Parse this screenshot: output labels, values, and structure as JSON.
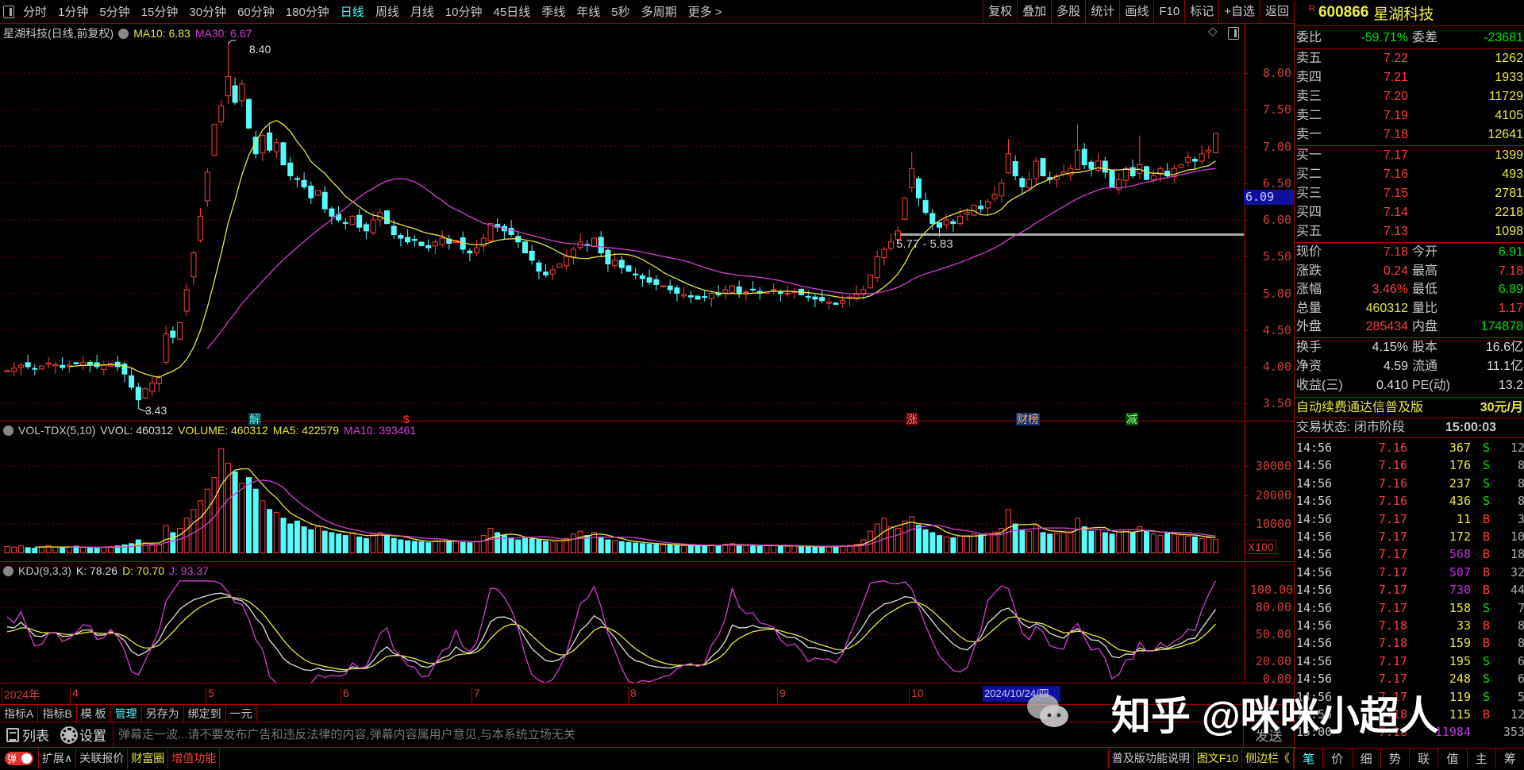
{
  "toolbar": {
    "periods": [
      "分时",
      "1分钟",
      "5分钟",
      "15分钟",
      "30分钟",
      "60分钟",
      "180分钟",
      "日线",
      "周线",
      "月线",
      "10分钟",
      "45日线",
      "季线",
      "年线",
      "5秒",
      "多周期",
      "更多 >"
    ],
    "active_period": "日线",
    "actions": [
      "复权",
      "叠加",
      "多股",
      "统计",
      "画线",
      "F10",
      "标记",
      "+自选",
      "返回"
    ]
  },
  "price_pane": {
    "title": "星湖科技(日线,前复权)",
    "ma10": "MA10: 6.83",
    "ma30": "MA30: 6.67",
    "high_label": "8.40",
    "low_label": "3.43",
    "range_label": "5.77 - 5.83",
    "current_price_tag": "6.09",
    "y_ticks": [
      "8.00",
      "7.50",
      "7.00",
      "6.50",
      "6.00",
      "5.50",
      "5.00",
      "4.50",
      "4.00",
      "3.50"
    ],
    "markers": [
      {
        "text": "解",
        "color": "#54fcfc",
        "bg": "#104040"
      },
      {
        "text": "$",
        "color": "#ff3030",
        "bg": "transparent"
      },
      {
        "text": "涨",
        "color": "#ff8080",
        "bg": "#600000"
      },
      {
        "text": "财榜",
        "color": "#ffb060",
        "bg": "#103070"
      },
      {
        "text": "减",
        "color": "#80ff80",
        "bg": "#0a500a"
      }
    ]
  },
  "volume_pane": {
    "name": "VOL-TDX(5,10)",
    "vvol": "VVOL: 460312",
    "volume": "VOLUME: 460312",
    "ma5": "MA5: 422579",
    "ma10": "MA10: 393461",
    "y_ticks": [
      "30000",
      "20000",
      "10000"
    ],
    "unit": "X100"
  },
  "kdj_pane": {
    "name": "KDJ(9,3,3)",
    "k": "K: 78.26",
    "d": "D: 70.70",
    "j": "J: 93.37",
    "y_ticks": [
      "100.00",
      "80.00",
      "50.00",
      "20.00",
      "0.00"
    ]
  },
  "date_axis": {
    "labels": [
      "2024年",
      "4",
      "5",
      "6",
      "7",
      "8",
      "9",
      "10"
    ],
    "cursor_date": "2024/10/24/四"
  },
  "indicator_tabs": [
    "指标A",
    "指标B",
    "模 板",
    "管理",
    "另存为",
    "绑定到",
    "一元"
  ],
  "list_bar": {
    "list_label": "列表",
    "settings_label": "设置",
    "danmaku_placeholder": "弹幕走一波...请不要发布广告和违反法律的内容,弹幕内容属用户意见,与本系统立场无关",
    "send_label": "发送"
  },
  "bottom_bar": {
    "toggle_label": "弹",
    "items": [
      "扩展∧",
      "关联报价",
      "财富圈",
      "增值功能"
    ],
    "right_items": [
      "普及版功能说明",
      "图文F10",
      "侧边栏《"
    ]
  },
  "quote": {
    "code": "600866",
    "name": "星湖科技",
    "badge": "R",
    "weibi": {
      "label": "委比",
      "value": "-59.71%",
      "label2": "委差",
      "value2": "-23681"
    },
    "sell": [
      {
        "label": "卖五",
        "price": "7.22",
        "vol": "1262"
      },
      {
        "label": "卖四",
        "price": "7.21",
        "vol": "1933"
      },
      {
        "label": "卖三",
        "price": "7.20",
        "vol": "11729"
      },
      {
        "label": "卖二",
        "price": "7.19",
        "vol": "4105"
      },
      {
        "label": "卖一",
        "price": "7.18",
        "vol": "12641"
      }
    ],
    "buy": [
      {
        "label": "买一",
        "price": "7.17",
        "vol": "1399"
      },
      {
        "label": "买二",
        "price": "7.16",
        "vol": "493"
      },
      {
        "label": "买三",
        "price": "7.15",
        "vol": "2781"
      },
      {
        "label": "买四",
        "price": "7.14",
        "vol": "2218"
      },
      {
        "label": "买五",
        "price": "7.13",
        "vol": "1098"
      }
    ],
    "stats": [
      {
        "l1": "现价",
        "v1": "7.18",
        "c1": "red",
        "l2": "今开",
        "v2": "6.91",
        "c2": "green"
      },
      {
        "l1": "涨跌",
        "v1": "0.24",
        "c1": "red",
        "l2": "最高",
        "v2": "7.18",
        "c2": "red"
      },
      {
        "l1": "涨幅",
        "v1": "3.46%",
        "c1": "red",
        "l2": "最低",
        "v2": "6.89",
        "c2": "green"
      },
      {
        "l1": "总量",
        "v1": "460312",
        "c1": "yellow",
        "l2": "量比",
        "v2": "1.17",
        "c2": "red"
      },
      {
        "l1": "外盘",
        "v1": "285434",
        "c1": "red",
        "l2": "内盘",
        "v2": "174878",
        "c2": "green"
      }
    ],
    "fundamentals": [
      {
        "l1": "换手",
        "v1": "4.15%",
        "l2": "股本",
        "v2": "16.6亿"
      },
      {
        "l1": "净资",
        "v1": "4.59",
        "l2": "流通",
        "v2": "11.1亿"
      },
      {
        "l1": "收益(三)",
        "v1": "0.410",
        "l2": "PE(动)",
        "v2": "13.2"
      }
    ],
    "promo": "自动续费通达信普及版",
    "promo_price": "30元/月",
    "status": "交易状态: 闭市阶段",
    "status_time": "15:00:03"
  },
  "trades": [
    {
      "t": "14:56",
      "p": "7.16",
      "v": "367",
      "bs": "S",
      "n": "12",
      "big": false
    },
    {
      "t": "14:56",
      "p": "7.16",
      "v": "176",
      "bs": "S",
      "n": "8",
      "big": false
    },
    {
      "t": "14:56",
      "p": "7.16",
      "v": "237",
      "bs": "S",
      "n": "8",
      "big": false
    },
    {
      "t": "14:56",
      "p": "7.16",
      "v": "436",
      "bs": "S",
      "n": "8",
      "big": false
    },
    {
      "t": "14:56",
      "p": "7.17",
      "v": "11",
      "bs": "B",
      "n": "3",
      "big": false
    },
    {
      "t": "14:56",
      "p": "7.17",
      "v": "172",
      "bs": "B",
      "n": "10",
      "big": false
    },
    {
      "t": "14:56",
      "p": "7.17",
      "v": "568",
      "bs": "B",
      "n": "18",
      "big": true
    },
    {
      "t": "14:56",
      "p": "7.17",
      "v": "507",
      "bs": "B",
      "n": "32",
      "big": true
    },
    {
      "t": "14:56",
      "p": "7.17",
      "v": "730",
      "bs": "B",
      "n": "44",
      "big": true
    },
    {
      "t": "14:56",
      "p": "7.17",
      "v": "158",
      "bs": "S",
      "n": "7",
      "big": false
    },
    {
      "t": "14:56",
      "p": "7.18",
      "v": "33",
      "bs": "B",
      "n": "8",
      "big": false
    },
    {
      "t": "14:56",
      "p": "7.18",
      "v": "159",
      "bs": "B",
      "n": "8",
      "big": false
    },
    {
      "t": "14:56",
      "p": "7.17",
      "v": "195",
      "bs": "S",
      "n": "6",
      "big": false
    },
    {
      "t": "14:56",
      "p": "7.17",
      "v": "248",
      "bs": "S",
      "n": "6",
      "big": false
    },
    {
      "t": "14:56",
      "p": "7.17",
      "v": "119",
      "bs": "S",
      "n": "5",
      "big": false
    },
    {
      "t": "14:56",
      "p": "7.18",
      "v": "115",
      "bs": "B",
      "n": "12",
      "big": false
    },
    {
      "t": "15:00",
      "p": "7.18",
      "v": "11984",
      "bs": "",
      "n": "353",
      "big": true
    }
  ],
  "side_tabs": [
    "笔",
    "价",
    "细",
    "势",
    "联",
    "值",
    "主",
    "筹"
  ],
  "watermark": "知乎 @咪咪小超人",
  "colors": {
    "up": "#ff3c3c",
    "down": "#54fcfc",
    "ma_short": "#e8e840",
    "ma_long": "#d040d0",
    "kdj_k": "#e0e0e0",
    "grid": "#a00000"
  },
  "chart_data": {
    "type": "candlestick",
    "title": "星湖科技 600866 日线",
    "price_ylim": [
      3.5,
      8.0
    ],
    "close": [
      3.95,
      3.98,
      4.02,
      4.0,
      3.97,
      4.01,
      4.05,
      4.03,
      3.99,
      4.02,
      4.04,
      4.06,
      4.03,
      4.0,
      4.02,
      4.05,
      4.0,
      3.9,
      3.72,
      3.55,
      3.7,
      3.78,
      3.85,
      4.45,
      4.4,
      4.6,
      5.05,
      5.55,
      6.05,
      6.65,
      7.3,
      7.55,
      7.95,
      7.6,
      7.85,
      7.25,
      6.9,
      7.15,
      6.95,
      7.05,
      6.75,
      6.6,
      6.55,
      6.45,
      6.3,
      6.4,
      6.15,
      6.05,
      6.0,
      5.95,
      6.05,
      5.9,
      5.85,
      6.0,
      6.1,
      5.95,
      5.8,
      5.75,
      5.7,
      5.72,
      5.65,
      5.62,
      5.7,
      5.75,
      5.68,
      5.72,
      5.6,
      5.55,
      5.62,
      5.75,
      5.95,
      5.9,
      5.85,
      5.8,
      5.7,
      5.55,
      5.45,
      5.3,
      5.25,
      5.32,
      5.4,
      5.5,
      5.6,
      5.7,
      5.65,
      5.75,
      5.55,
      5.4,
      5.45,
      5.35,
      5.3,
      5.25,
      5.2,
      5.15,
      5.12,
      5.1,
      5.05,
      5.0,
      4.98,
      4.95,
      4.92,
      4.95,
      5.0,
      4.98,
      5.05,
      5.1,
      5.0,
      5.02,
      5.05,
      5.0,
      5.02,
      5.05,
      5.0,
      5.0,
      5.02,
      4.98,
      4.95,
      4.92,
      4.9,
      4.88,
      4.85,
      4.9,
      4.95,
      5.0,
      5.05,
      5.25,
      5.5,
      5.6,
      5.7,
      5.85,
      6.3,
      6.7,
      6.3,
      6.1,
      5.95,
      5.9,
      6.0,
      5.95,
      6.05,
      6.1,
      6.2,
      6.15,
      6.25,
      6.35,
      6.5,
      6.9,
      6.6,
      6.45,
      6.55,
      6.8,
      6.6,
      6.55,
      6.6,
      6.65,
      6.7,
      6.95,
      6.75,
      6.7,
      6.8,
      6.65,
      6.45,
      6.55,
      6.7,
      6.6,
      6.75,
      6.55,
      6.6,
      6.7,
      6.6,
      6.7,
      6.75,
      6.85,
      6.8,
      6.9,
      6.95,
      7.18
    ],
    "high_overrides": {
      "32": 8.4,
      "131": 6.92,
      "145": 7.1,
      "155": 7.3,
      "164": 7.15,
      "175": 7.18
    },
    "low_overrides": {
      "19": 3.43,
      "135": 5.77
    },
    "volume_x100": [
      2200,
      2000,
      2500,
      1800,
      1600,
      2100,
      2600,
      2000,
      1700,
      1900,
      2300,
      2000,
      1800,
      1600,
      1900,
      2200,
      2400,
      2800,
      3200,
      4500,
      3500,
      3000,
      2800,
      9500,
      7000,
      8500,
      12000,
      15000,
      18000,
      22000,
      26000,
      36000,
      31000,
      28000,
      24000,
      26000,
      22000,
      18000,
      15000,
      14000,
      12000,
      10000,
      11000,
      9000,
      8000,
      9000,
      7500,
      7000,
      6500,
      6000,
      7000,
      5500,
      5000,
      6500,
      7000,
      6000,
      5000,
      4500,
      4200,
      4000,
      3800,
      3500,
      4200,
      4800,
      4000,
      3900,
      3600,
      3500,
      4000,
      6000,
      8500,
      7000,
      6000,
      5000,
      4500,
      5000,
      4800,
      4500,
      4000,
      3800,
      4200,
      5000,
      6500,
      7500,
      6000,
      7000,
      5500,
      4500,
      4200,
      3900,
      3600,
      3400,
      3200,
      3000,
      2900,
      2800,
      2700,
      2600,
      2500,
      2400,
      2500,
      2600,
      2800,
      2500,
      3000,
      3200,
      2600,
      2500,
      2700,
      2400,
      2500,
      2600,
      2400,
      2300,
      2400,
      2200,
      2100,
      2000,
      2100,
      2200,
      2400,
      2500,
      2600,
      3000,
      4500,
      7500,
      10000,
      12000,
      9000,
      8500,
      11000,
      12500,
      9500,
      8000,
      7000,
      6000,
      5500,
      5200,
      5800,
      6000,
      6500,
      6200,
      6800,
      7200,
      8500,
      15000,
      10000,
      8000,
      7500,
      9500,
      7000,
      6500,
      6800,
      7000,
      7500,
      12000,
      9000,
      7500,
      8000,
      7000,
      6500,
      7200,
      8000,
      7000,
      9000,
      7500,
      6500,
      6000,
      6800,
      6500,
      6200,
      5800,
      5500,
      5000,
      5200,
      4603
    ],
    "volume_ylim": [
      0,
      36000
    ],
    "kdj_ylim": [
      0,
      100
    ],
    "ma_periods": [
      10,
      30
    ],
    "vol_ma_periods": [
      5,
      10
    ],
    "kdj_params": [
      9,
      3,
      3
    ]
  }
}
